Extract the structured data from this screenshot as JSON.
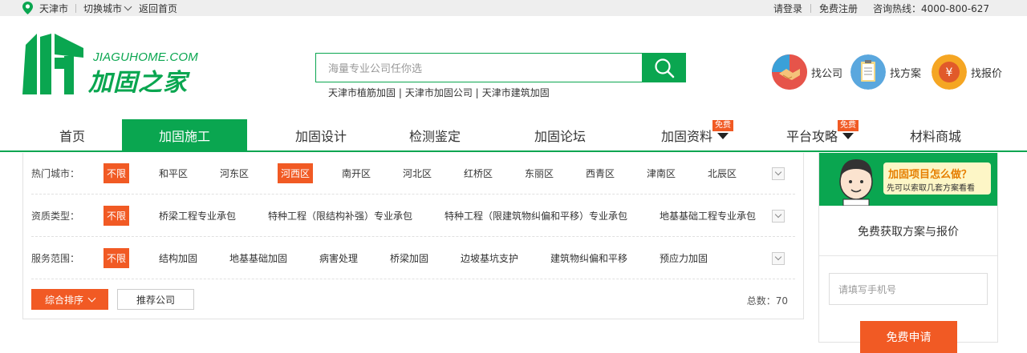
{
  "topbar": {
    "city": "天津市",
    "switch_city": "切换城市",
    "back_home": "返回首页",
    "login": "请登录",
    "register": "免费注册",
    "hotline": "咨询热线：4000-800-627"
  },
  "logo": {
    "en": "JIAGUHOME.COM",
    "cn": "加固之家"
  },
  "search": {
    "placeholder": "海量专业公司任你选",
    "hotwords": [
      "天津市植筋加固 |",
      "天津市加固公司 |",
      "天津市建筑加固"
    ]
  },
  "quick": {
    "company": "找公司",
    "plan": "找方案",
    "price": "找报价"
  },
  "nav": {
    "items": [
      "首页",
      "加固施工",
      "加固设计",
      "检测鉴定",
      "加固论坛",
      "加固资料",
      "平台攻略",
      "材料商城"
    ],
    "badge": "免费"
  },
  "filters": {
    "city": {
      "label": "热门城市：",
      "options": [
        "不限",
        "和平区",
        "河东区",
        "河西区",
        "南开区",
        "河北区",
        "红桥区",
        "东丽区",
        "西青区",
        "津南区",
        "北辰区"
      ]
    },
    "qual": {
      "label": "资质类型：",
      "options": [
        "不限",
        "桥梁工程专业承包",
        "特种工程（限结构补强）专业承包",
        "特种工程（限建筑物纠偏和平移）专业承包",
        "地基基础工程专业承包"
      ]
    },
    "service": {
      "label": "服务范围：",
      "options": [
        "不限",
        "结构加固",
        "地基基础加固",
        "病害处理",
        "桥梁加固",
        "边坡基坑支护",
        "建筑物纠偏和平移",
        "预应力加固"
      ]
    }
  },
  "sort": {
    "combined": "综合排序",
    "recommend": "推荐公司",
    "total": "总数：70"
  },
  "side": {
    "question": "加固项目怎么做？",
    "answer": "先可以索取几套方案看看",
    "title": "免费获取方案与报价",
    "phone_placeholder": "请填写手机号",
    "apply": "免费申请"
  }
}
